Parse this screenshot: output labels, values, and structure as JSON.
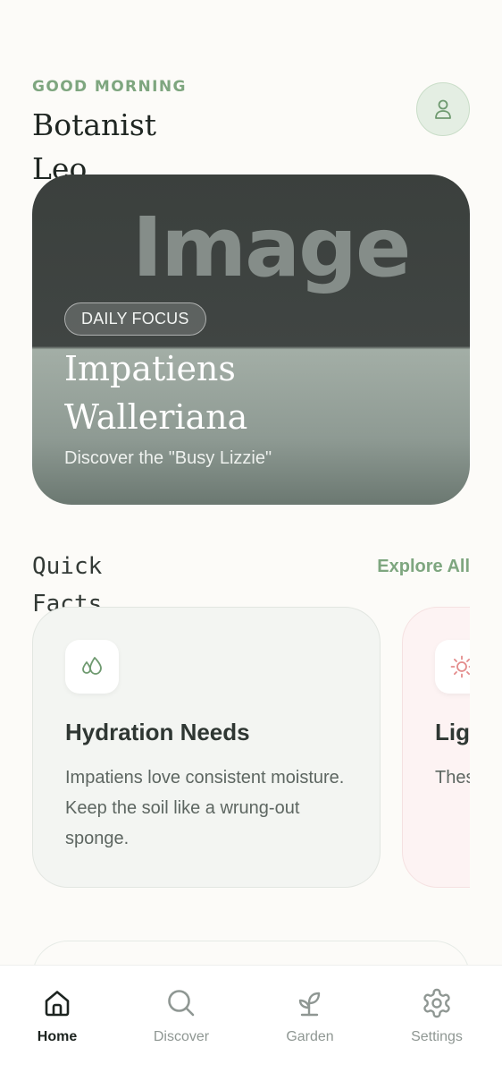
{
  "header": {
    "greeting": "GOOD MORNING",
    "user_name": "Botanist Leo",
    "avatar_icon": "user-icon"
  },
  "hero": {
    "image_placeholder": "Image",
    "badge": "DAILY FOCUS",
    "title": "Impatiens Walleriana",
    "subtitle": "Discover the \"Busy Lizzie\""
  },
  "quick_facts": {
    "title": "Quick Facts",
    "explore_label": "Explore All",
    "cards": [
      {
        "icon": "water-drops-icon",
        "title": "Hydration Needs",
        "text": "Impatiens love consistent moisture. Keep the soil like a wrung-out sponge."
      },
      {
        "icon": "sun-icon",
        "title": "Lig",
        "text": "Thes to d wilt"
      }
    ]
  },
  "nav": {
    "items": [
      {
        "label": "Home",
        "icon": "home-icon",
        "active": true
      },
      {
        "label": "Discover",
        "icon": "search-icon",
        "active": false
      },
      {
        "label": "Garden",
        "icon": "sprout-icon",
        "active": false
      },
      {
        "label": "Settings",
        "icon": "gear-icon",
        "active": false
      }
    ]
  },
  "colors": {
    "accent": "#7ea67f",
    "background": "#fcfbf8",
    "text_dark": "#1f2622",
    "sun_accent": "#e38b8b"
  }
}
